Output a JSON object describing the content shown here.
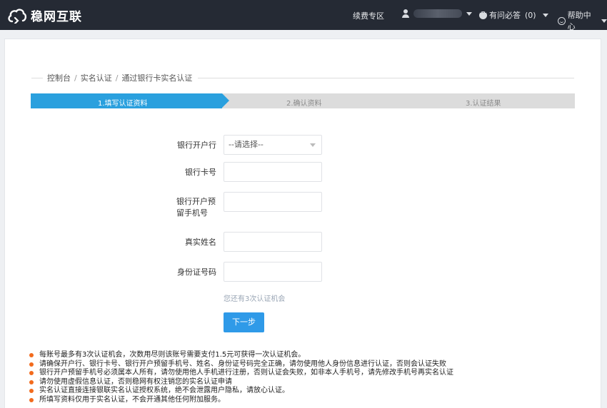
{
  "header": {
    "logo_text": "稳网互联",
    "renew_link": "续费专区",
    "qa_label": "有问必答",
    "qa_count": "(0)",
    "help_label": "帮助中心",
    "colors": {
      "bar": "#252a34",
      "accent": "#2aa0de"
    }
  },
  "breadcrumb": {
    "items": [
      "控制台",
      "实名认证",
      "通过银行卡实名认证"
    ],
    "separator": "/"
  },
  "steps": [
    {
      "label": "1.填写认证资料",
      "active": true
    },
    {
      "label": "2.确认资料",
      "active": false
    },
    {
      "label": "3.认证结果",
      "active": false
    }
  ],
  "form": {
    "bank_label": "银行开户行",
    "bank_value": "--请选择--",
    "card_label": "银行卡号",
    "phone_label": "银行开户预留手机号",
    "name_label": "真实姓名",
    "id_label": "身份证号码",
    "attempts_hint": "您还有3次认证机会",
    "next_button": "下一步"
  },
  "notes": [
    "每账号最多有3次认证机会，次数用尽则该账号需要支付1.5元可获得一次认证机会。",
    "请确保开户行、银行卡号、银行开户预留手机号、姓名、身份证号码完全正确，请勿使用他人身份信息进行认证，否则会认证失败",
    "银行开户预留手机号必须属本人所有，请勿使用他人手机进行注册，否则认证会失败，如非本人手机号，请先修改手机号再实名认证",
    "请勿使用虚假信息认证，否则稳网有权注销您的实名认证申请",
    "实名认证直接连接银联实名认证授权系统，绝不会泄露用户隐私，请放心认证。",
    "所填写资料仅用于实名认证，不会开通其他任何附加服务。"
  ]
}
